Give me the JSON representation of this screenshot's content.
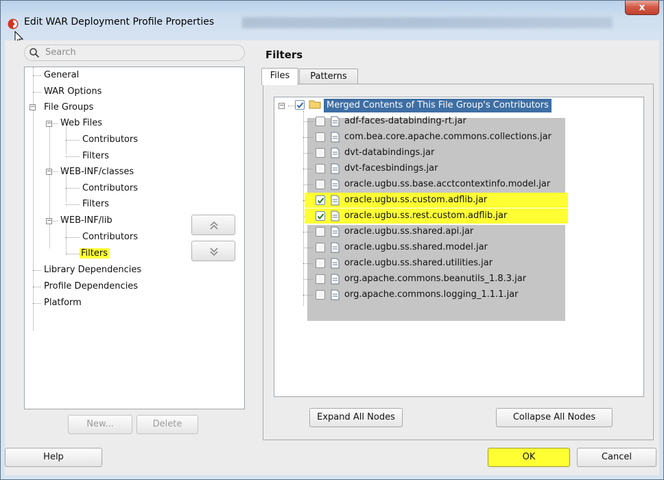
{
  "window": {
    "title": "Edit WAR Deployment Profile Properties",
    "close_glyph": "x"
  },
  "search": {
    "placeholder": "Search"
  },
  "tree": {
    "items": [
      {
        "label": "General"
      },
      {
        "label": "WAR Options"
      },
      {
        "label": "File Groups"
      },
      {
        "label": "Web Files"
      },
      {
        "label": "Contributors"
      },
      {
        "label": "Filters"
      },
      {
        "label": "WEB-INF/classes"
      },
      {
        "label": "Contributors"
      },
      {
        "label": "Filters"
      },
      {
        "label": "WEB-INF/lib"
      },
      {
        "label": "Contributors"
      },
      {
        "label": "Filters",
        "selected": true
      },
      {
        "label": "Library Dependencies"
      },
      {
        "label": "Profile Dependencies"
      },
      {
        "label": "Platform"
      }
    ]
  },
  "tree_buttons": {
    "new": "New...",
    "delete": "Delete"
  },
  "panel": {
    "title": "Filters",
    "tabs": [
      {
        "label": "Files",
        "active": true
      },
      {
        "label": "Patterns",
        "active": false
      }
    ],
    "root_label": "Merged Contents of This File Group's Contributors",
    "files": [
      {
        "name": "adf-faces-databinding-rt.jar",
        "checked": false
      },
      {
        "name": "com.bea.core.apache.commons.collections.jar",
        "checked": false
      },
      {
        "name": "dvt-databindings.jar",
        "checked": false
      },
      {
        "name": "dvt-facesbindings.jar",
        "checked": false
      },
      {
        "name": "oracle.ugbu.ss.base.acctcontextinfo.model.jar",
        "checked": false
      },
      {
        "name": "oracle.ugbu.ss.custom.adflib.jar",
        "checked": true
      },
      {
        "name": "oracle.ugbu.ss.rest.custom.adflib.jar",
        "checked": true
      },
      {
        "name": "oracle.ugbu.ss.shared.api.jar",
        "checked": false
      },
      {
        "name": "oracle.ugbu.ss.shared.model.jar",
        "checked": false
      },
      {
        "name": "oracle.ugbu.ss.shared.utilities.jar",
        "checked": false
      },
      {
        "name": "org.apache.commons.beanutils_1.8.3.jar",
        "checked": false
      },
      {
        "name": "org.apache.commons.logging_1.1.1.jar",
        "checked": false
      }
    ],
    "expand_all": "Expand All Nodes",
    "collapse_all": "Collapse All Nodes"
  },
  "footer": {
    "help": "Help",
    "ok": "OK",
    "cancel": "Cancel"
  },
  "colors": {
    "highlight": "#ffff33",
    "selection": "#3e6ea3",
    "gray_overlay": "#c5c5c5"
  }
}
